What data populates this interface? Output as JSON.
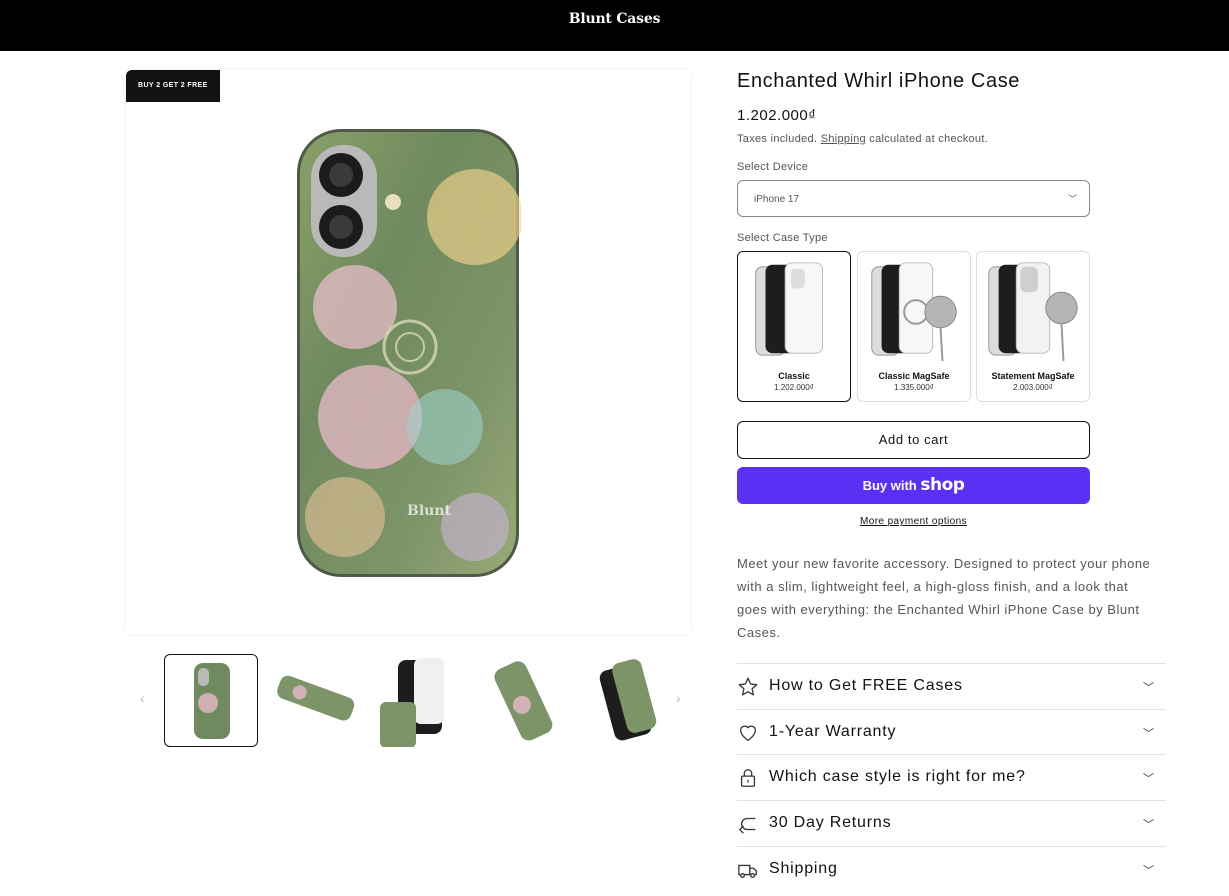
{
  "header": {
    "brand": "Blunt Cases"
  },
  "gallery": {
    "badge": "BUY 2 GET 2 FREE",
    "prev_icon": "chevron-left-icon",
    "next_icon": "chevron-right-icon",
    "thumbnails": [
      "thumbnail",
      "thumbnail",
      "thumbnail",
      "thumbnail",
      "thumbnail"
    ]
  },
  "product": {
    "title": "Enchanted Whirl iPhone Case",
    "price": "1.202.000₫",
    "tax_prefix": "Taxes included.",
    "tax_link": "Shipping",
    "tax_suffix": "calculated at checkout.",
    "device_label": "Select Device",
    "device_value": "iPhone 17",
    "case_type_label": "Select Case Type",
    "case_types": [
      {
        "name": "Classic",
        "price": "1.202.000₫"
      },
      {
        "name": "Classic MagSafe",
        "price": "1.335.000₫"
      },
      {
        "name": "Statement MagSafe",
        "price": "2.003.000₫"
      }
    ],
    "add_to_cart": "Add to cart",
    "buy_with": "Buy with",
    "shop_logo": "shop",
    "more_payment": "More payment options",
    "description": "Meet your new favorite accessory. Designed to protect your phone with a slim, lightweight feel, a high-gloss finish, and a look that goes with everything: the Enchanted Whirl iPhone Case by Blunt Cases."
  },
  "accordions": [
    {
      "label": "How to Get FREE Cases",
      "icon": "star-icon"
    },
    {
      "label": "1-Year Warranty",
      "icon": "heart-icon"
    },
    {
      "label": "Which case style is right for me?",
      "icon": "lock-icon"
    },
    {
      "label": "30 Day Returns",
      "icon": "return-arrow-icon"
    },
    {
      "label": "Shipping",
      "icon": "truck-icon"
    }
  ],
  "colors": {
    "shop_button": "#5a31f4",
    "header_bg": "#000000",
    "case_green": "#6f8a5e"
  }
}
